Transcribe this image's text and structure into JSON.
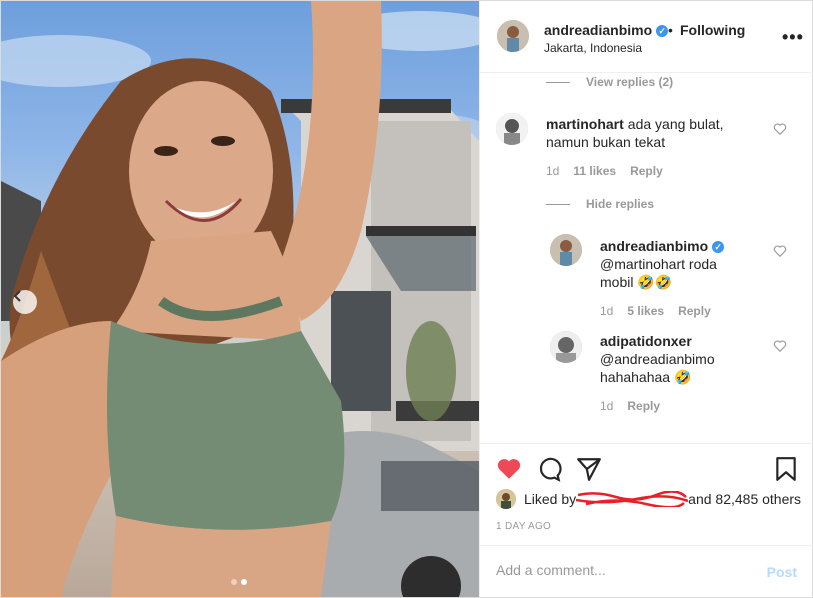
{
  "header": {
    "username": "andreadianbimo",
    "separator": "•",
    "follow_state": "Following",
    "location": "Jakarta, Indonesia",
    "more_icon": "more-dots-icon"
  },
  "comments": [
    {
      "toggle_label": "View replies (2)"
    },
    {
      "username": "martinohart",
      "text": "ada yang bulat, namun bukan tekat",
      "age": "1d",
      "likes": "11 likes",
      "reply": "Reply",
      "toggle_label": "Hide replies"
    }
  ],
  "replies": [
    {
      "username": "andreadianbimo",
      "text": "@martinohart roda mobil 🤣🤣",
      "age": "1d",
      "likes": "5 likes",
      "reply": "Reply"
    },
    {
      "username": "adipatidonxer",
      "text": "@andreadianbimo hahahahaa 🤣",
      "age": "1d",
      "reply": "Reply"
    }
  ],
  "likes": {
    "prefix": "Liked by",
    "suffix": "and 82,485 others"
  },
  "timestamp": "1 DAY AGO",
  "composer": {
    "placeholder": "Add a comment...",
    "post_label": "Post"
  },
  "colors": {
    "heart_liked": "#ed4956",
    "verified": "#3897f0",
    "post_disabled": "#b3dbff"
  },
  "carousel": {
    "slides": 2,
    "active": 2
  }
}
